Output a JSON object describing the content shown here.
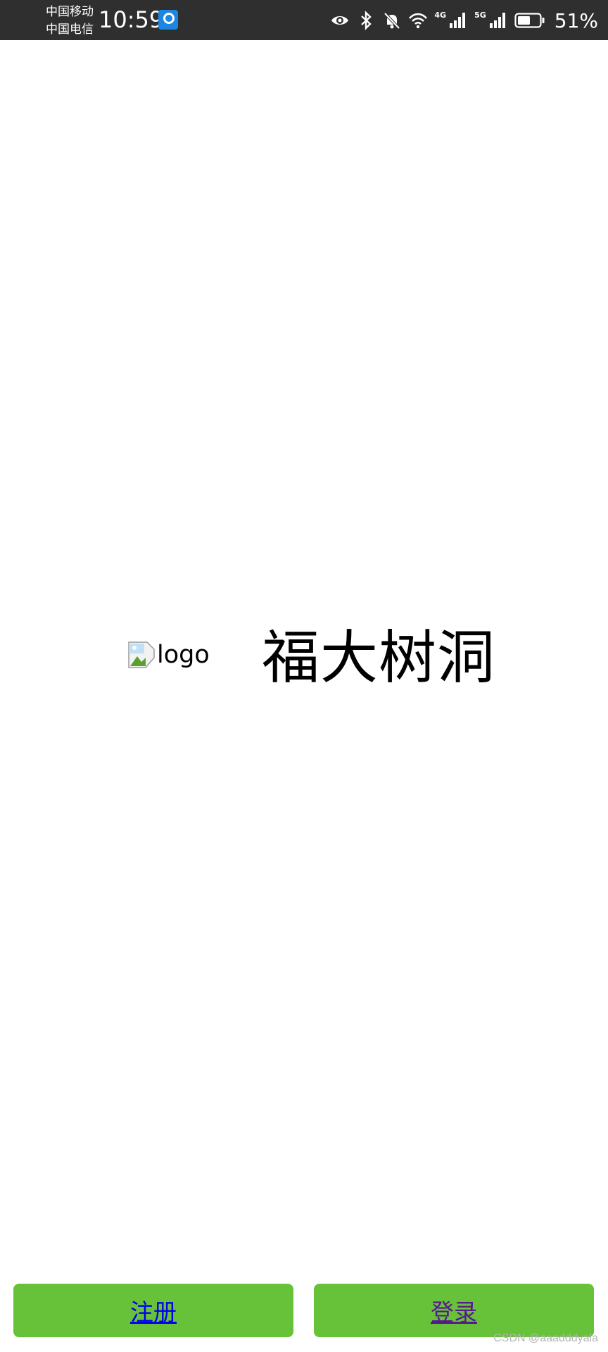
{
  "status_bar": {
    "carrier_1": "中国移动",
    "carrier_2": "中国电信",
    "time": "10:59",
    "net_4g": "4G",
    "net_5g": "5G",
    "battery_percent": "51%",
    "icons": [
      "eye-icon",
      "bluetooth-icon",
      "bell-off-icon",
      "wifi-icon",
      "signal-4g-icon",
      "signal-5g-icon",
      "battery-icon"
    ]
  },
  "brand": {
    "logo_alt": "logo",
    "title": "福大树洞"
  },
  "actions": {
    "register_label": "注册",
    "login_label": "登录"
  },
  "watermark": "CSDN @aaadddyala",
  "colors": {
    "status_bar_bg": "#2f2f2f",
    "button_bg": "#67c23a",
    "link_unvisited": "#0000ee",
    "link_visited": "#551a8b"
  }
}
